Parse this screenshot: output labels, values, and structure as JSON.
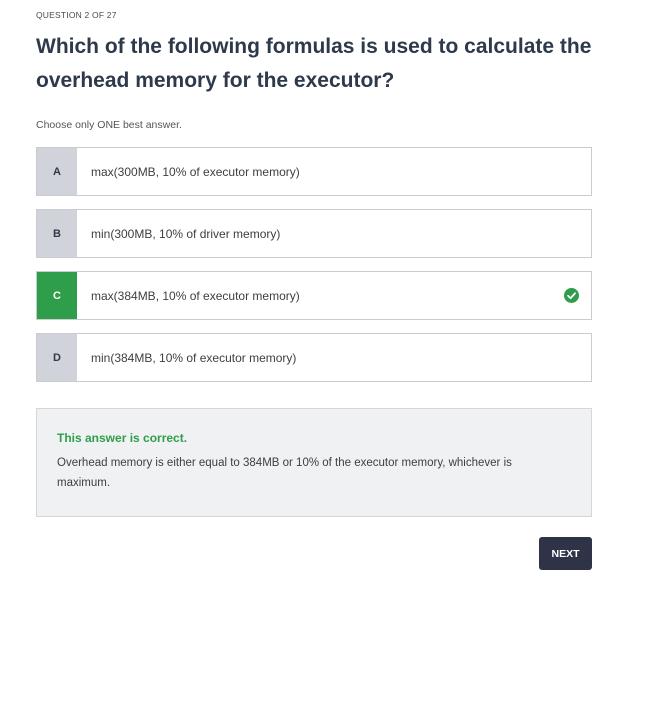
{
  "question": {
    "counter": "QUESTION 2 OF 27",
    "title": "Which of the following formulas is used to calculate the overhead memory for the executor?",
    "instruction": "Choose only ONE best answer."
  },
  "options": [
    {
      "letter": "A",
      "text": "max(300MB, 10% of executor memory)",
      "state": "default"
    },
    {
      "letter": "B",
      "text": "min(300MB, 10% of driver memory)",
      "state": "default"
    },
    {
      "letter": "C",
      "text": "max(384MB, 10% of executor memory)",
      "state": "correct",
      "icon": "check-circle-icon"
    },
    {
      "letter": "D",
      "text": "min(384MB, 10% of executor memory)",
      "state": "default"
    }
  ],
  "feedback": {
    "status": "This answer is correct.",
    "explanation": "Overhead memory is either equal to 384MB or 10% of the executor memory, whichever is maximum."
  },
  "actions": {
    "next_label": "NEXT"
  },
  "colors": {
    "correct_green": "#2f9e4b",
    "letter_bg": "#d0d3d9",
    "title_text": "#2e3a4b",
    "button_bg": "#2e3347",
    "feedback_bg": "#f0f1f3"
  }
}
